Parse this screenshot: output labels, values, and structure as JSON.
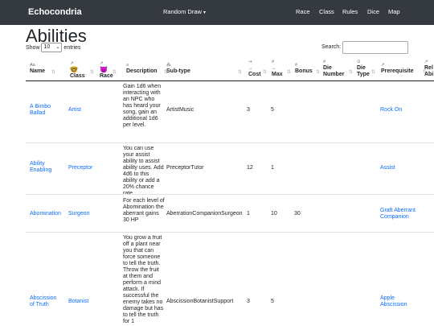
{
  "nav": {
    "brand": "Echocondria",
    "random_draw": "Random Draw",
    "caret": "▾",
    "items": [
      "Race",
      "Class",
      "Rules",
      "Dice",
      "Map"
    ]
  },
  "page": {
    "title": "Abilities",
    "show_label": "Show",
    "entries_value": "10",
    "entries_label": "entries",
    "search_label": "Search:"
  },
  "table": {
    "headers": [
      {
        "icon": "Aa",
        "label": "Name"
      },
      {
        "icon": "↗",
        "label": "Class"
      },
      {
        "icon": "↗",
        "label": "Race"
      },
      {
        "icon": "≡",
        "label": "Description"
      },
      {
        "icon": "⁂",
        "label": "Sub-type"
      },
      {
        "icon": "↔",
        "label": "Cost"
      },
      {
        "icon": "#",
        "label": "Max"
      },
      {
        "icon": "#",
        "label": "Bonus"
      },
      {
        "icon": "#",
        "label": "Die Number"
      },
      {
        "icon": "⊙",
        "label": "Die Type"
      },
      {
        "icon": "↗",
        "label": "Prerequisite"
      },
      {
        "icon": "↗",
        "label": "Rel Abi"
      }
    ],
    "rows": [
      {
        "name": "A Bimbo Ballad",
        "class": "Artist",
        "race": "",
        "description": "Gain 1d6 when interacting with an NPC who has heard your song, gain an additional 1d6 per level.",
        "subtype": "ArtistMusic",
        "cost": "3",
        "max": "5",
        "bonus": "",
        "prerequisite": "Rock On"
      },
      {
        "name": "Ability Enabling",
        "class": "Preceptor",
        "race": "",
        "description": "You can use your assist ability to assist ability uses. Add 4d6 to this ability or add a 20% chance rate.",
        "subtype": "PreceptorTutor",
        "cost": "12",
        "max": "1",
        "bonus": "",
        "prerequisite": "Assist"
      },
      {
        "name": "Abomination",
        "class": "Surgeon",
        "race": "",
        "description": "For each level of Abomination the aberrant gains 30 HP",
        "subtype": "AberrationCompanionSurgeon",
        "cost": "1",
        "max": "10",
        "bonus": "30",
        "prerequisite": "Graft Aberrant Companion"
      },
      {
        "name": "Abscission of Truth",
        "class": "Botanist",
        "race": "",
        "description": "You grow a fruit off a plant near you that can force someone to tell the truth. Throw the fruit at them and perform a mind attack. If successful the enemy takes no damage but has to tell the truth for 1",
        "subtype": "AbscissionBotanistSupport",
        "cost": "3",
        "max": "5",
        "bonus": "",
        "prerequisite": "Apple Abscission"
      }
    ]
  }
}
